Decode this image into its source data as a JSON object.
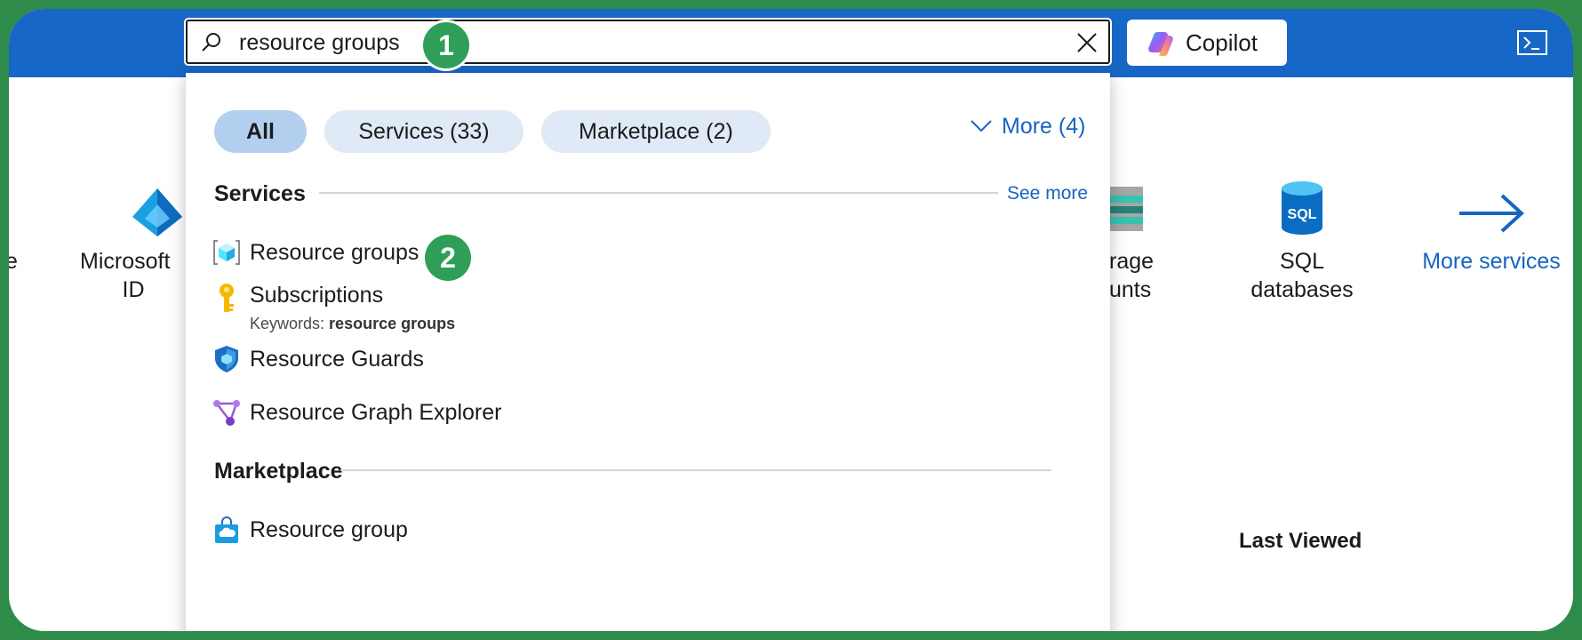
{
  "search": {
    "value": "resource groups",
    "step_badge": "1"
  },
  "copilot": {
    "label": "Copilot"
  },
  "background_tiles": [
    {
      "label": "e"
    },
    {
      "label": "Microsoft",
      "label_line2": "ID"
    },
    {
      "label": "rage",
      "label_line2": "unts"
    },
    {
      "label": "SQL databases"
    },
    {
      "label": "More services"
    }
  ],
  "last_viewed": {
    "label": "Last Viewed"
  },
  "dropdown": {
    "filters": [
      {
        "label": "All"
      },
      {
        "label": "Services  (33)"
      },
      {
        "label": "Marketplace  (2)"
      }
    ],
    "more_filter": "More (4)",
    "services_section": {
      "title": "Services",
      "see_more": "See more",
      "step_badge": "2",
      "results": [
        {
          "label": "Resource groups",
          "icon": "resource-groups-icon"
        },
        {
          "label": "Subscriptions",
          "icon": "key-icon",
          "keywords_prefix": "Keywords: ",
          "keywords_value": "resource groups"
        },
        {
          "label": "Resource Guards",
          "icon": "shield-icon"
        },
        {
          "label": "Resource Graph Explorer",
          "icon": "graph-icon"
        }
      ]
    },
    "marketplace_section": {
      "title": "Marketplace",
      "results": [
        {
          "label": "Resource group",
          "icon": "shopping-bag-icon"
        }
      ]
    }
  },
  "colors": {
    "topbar": "#1767c6",
    "accent_link": "#1764c1",
    "badge_green": "#2e9e58",
    "frame_green": "#2e8b4a"
  }
}
